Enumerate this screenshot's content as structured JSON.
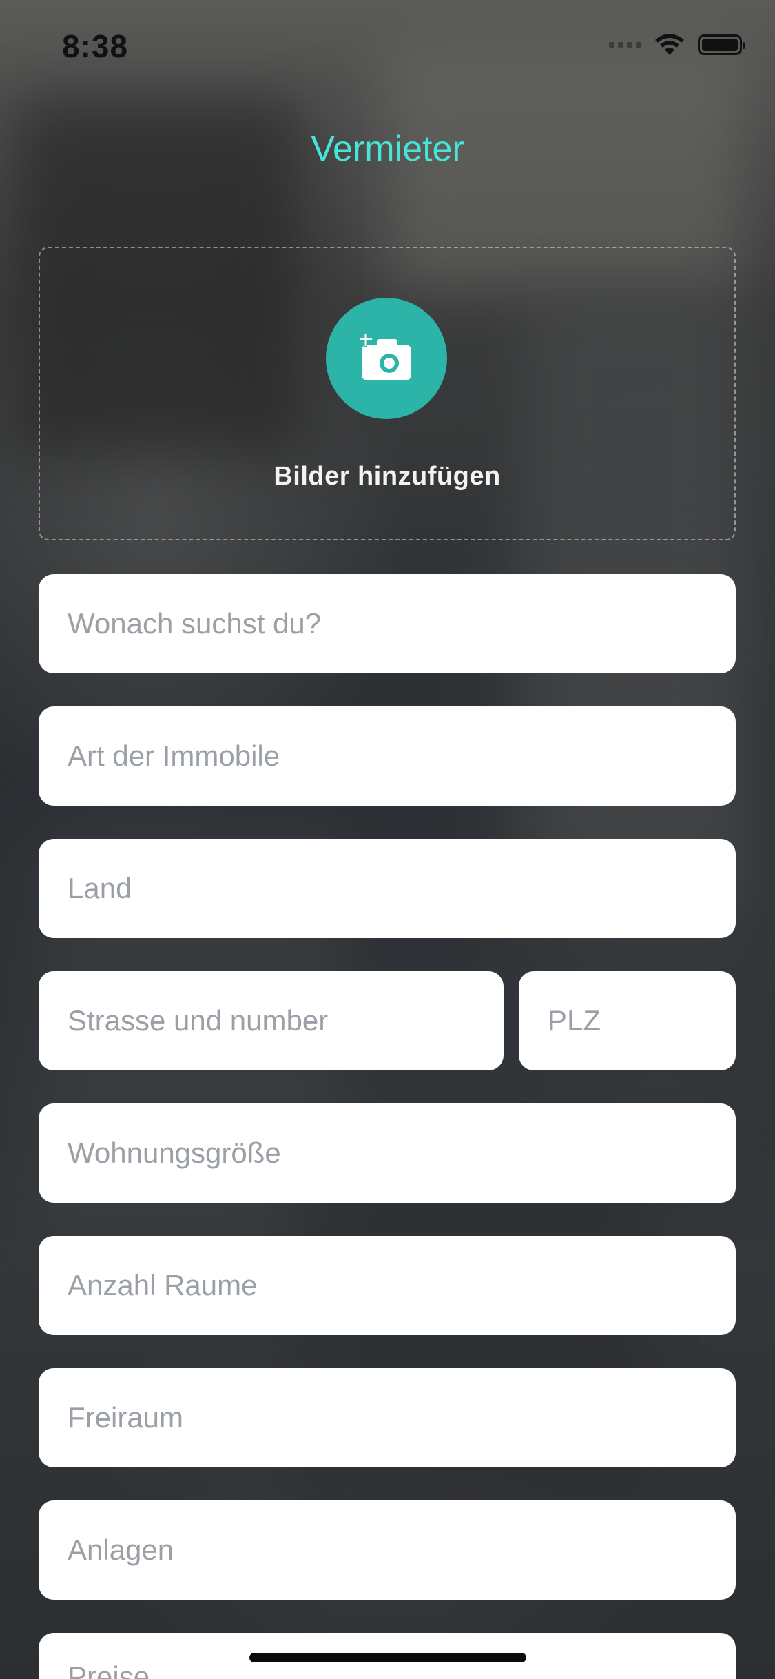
{
  "status_bar": {
    "time": "8:38"
  },
  "header": {
    "title": "Vermieter"
  },
  "image_upload": {
    "label": "Bilder hinzufügen",
    "icon": "add-photo-icon"
  },
  "form": {
    "fields": [
      {
        "placeholder": "Wonach suchst du?"
      },
      {
        "placeholder": "Art der Immobile"
      },
      {
        "placeholder": "Land"
      },
      {
        "placeholder": "Strasse und number"
      },
      {
        "placeholder": "PLZ"
      },
      {
        "placeholder": "Wohnungsgröße"
      },
      {
        "placeholder": "Anzahl Raume"
      },
      {
        "placeholder": "Freiraum"
      },
      {
        "placeholder": "Anlagen"
      },
      {
        "placeholder": "Preise"
      }
    ]
  },
  "colors": {
    "accent": "#45e6d8",
    "camera_button": "#2db4a8",
    "field_background": "#ffffff",
    "placeholder_text": "#9aa0a6"
  }
}
